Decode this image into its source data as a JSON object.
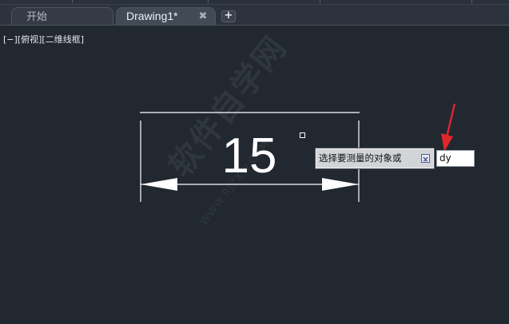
{
  "tabs": [
    {
      "label": "开始",
      "active": false
    },
    {
      "label": "Drawing1*",
      "active": true,
      "close_glyph": "✖"
    }
  ],
  "add_tab_glyph": "+",
  "viewport": {
    "minus_control": "[−]",
    "view_control": "[俯视]",
    "style_control": "[二维线框]"
  },
  "drawing": {
    "dimension_value": "15",
    "line_color": "#ffffff"
  },
  "command": {
    "prompt": "选择要测量的对象或",
    "options_icon": "dropdown-options-icon",
    "input_value": "dy"
  },
  "annotation": {
    "arrow_color": "#e0262b"
  },
  "watermark": {
    "text": "软件自学网",
    "url": "WWW.RJZXW.COM"
  },
  "colors": {
    "background": "#212830",
    "tab_active": "#424a55",
    "tooltip_bg": "#d2d4d7"
  }
}
